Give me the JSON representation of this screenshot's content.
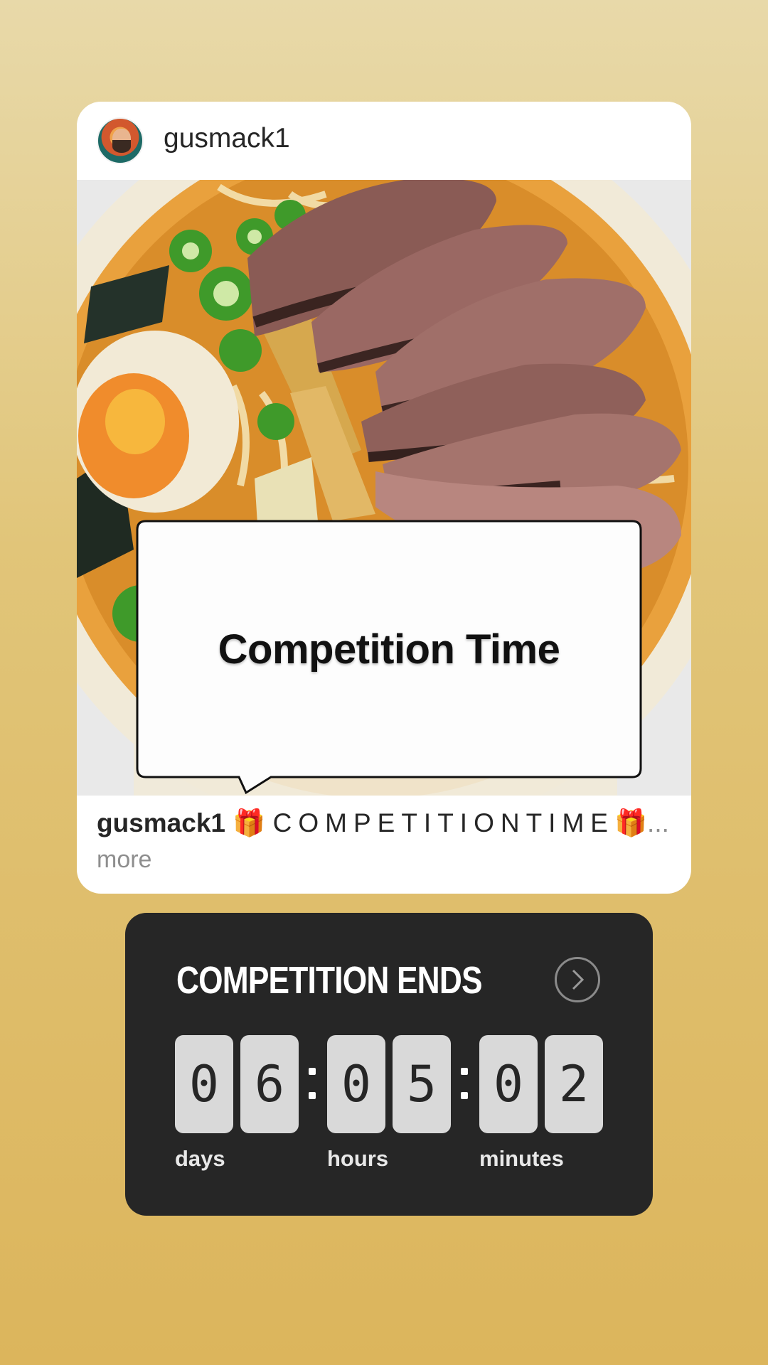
{
  "post": {
    "username": "gusmack1",
    "sticker_text": "Competition Time",
    "caption": {
      "username": "gusmack1",
      "emoji_left": "🎁",
      "text": "COMPETITIONTIME",
      "emoji_right": "🎁",
      "ellipsis": "...",
      "more": "more"
    }
  },
  "countdown": {
    "title": "COMPETITION ENDS",
    "digits": [
      "0",
      "6",
      "0",
      "5",
      "0",
      "2"
    ],
    "labels": {
      "days": "days",
      "hours": "hours",
      "minutes": "minutes"
    }
  },
  "colors": {
    "background_top": "#e8d9a9",
    "background_bottom": "#dcb55c",
    "card": "#ffffff",
    "countdown_panel": "#262626",
    "digit_tile": "#d9d9d9"
  }
}
